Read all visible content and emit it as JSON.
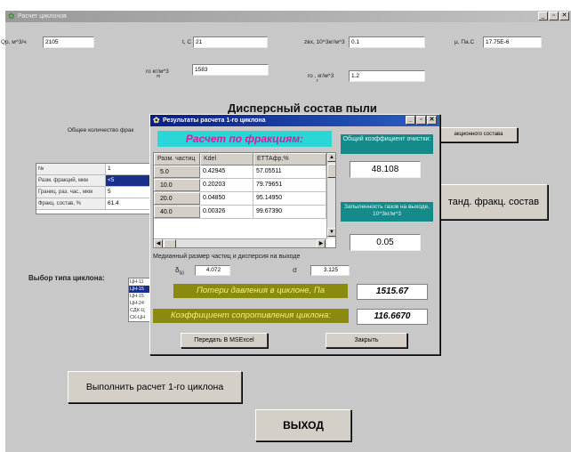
{
  "main_window": {
    "title": "Расчет циклонов",
    "title_buttons": [
      "_",
      "▫",
      "✕"
    ]
  },
  "inputs_row1": [
    {
      "label": "Qр, м^3/ч",
      "value": "2105"
    },
    {
      "label": "t, C",
      "value": "21"
    },
    {
      "label": "zвх, 10^3кг/м^3",
      "value": "0.1"
    },
    {
      "label": "μ, Па.С",
      "value": "17.75E-6"
    }
  ],
  "inputs_row2": [
    {
      "label": "ro  кг/м^3",
      "sub": "m",
      "value": "1583"
    },
    {
      "label": "ro , кг/м^3",
      "sub": "г",
      "value": "1.2"
    }
  ],
  "dispersion_heading": "Дисперсный состав пыли",
  "total_fractions_label": "Общее количество фрак",
  "fraction_comp_button": "акционного состава",
  "standard_comp_button": "танд. фракц. состав",
  "fraction_grid": [
    {
      "label": "№",
      "value": "1",
      "selected": false
    },
    {
      "label": "Разм. фракций, мкм",
      "value": "<5",
      "selected": true
    },
    {
      "label": "Границ. раз. час., мкм",
      "value": "5",
      "selected": false
    },
    {
      "label": "Фракц. состав, %",
      "value": "61.4",
      "selected": false
    }
  ],
  "cyclone_type_label": "Выбор типа циклона:",
  "cyclone_types": [
    "ЦН-11",
    "ЦН-15",
    "ЦН-15",
    "ЦН-24",
    "СДК-Ц",
    "СК-ЦН"
  ],
  "run_button": "Выполнить расчет 1-го циклона",
  "exit_button": "ВЫХОД",
  "dialog": {
    "title": "Результаты расчета 1-го циклона",
    "title_buttons": [
      "_",
      "▫",
      "✕"
    ],
    "fractions_banner": "Расчет по фракциям:",
    "table": {
      "headers": [
        "Разм. частиц",
        "Kdel",
        "ЕТТАфр,%"
      ],
      "rows": [
        [
          "5.0",
          "0.42945",
          "57.05511"
        ],
        [
          "10.0",
          "0.20203",
          "79.79651"
        ],
        [
          "20.0",
          "0.04850",
          "95.14950"
        ],
        [
          "40.0",
          "0.00326",
          "99.67390"
        ]
      ]
    },
    "overall_eff_label": "Общий коэффициент очистки:",
    "overall_eff_value": "48.108",
    "outlet_dust_label": "Запыленность газов на выходе, 10^3кг/м^3",
    "outlet_dust_value": "0.05",
    "median_label": "Медианный размер частиц и дисперсия на выходе",
    "d50_symbol": "δ",
    "d50_sub": "50",
    "d50_value": "4.072",
    "sigma_symbol": "σ",
    "sigma_value": "3.125",
    "pressure_loss_label": "Потери давления в циклоне,  Па",
    "pressure_loss_value": "1515.67",
    "resistance_label": "Коэффициент сопротивления циклона:",
    "resistance_value": "116.6670",
    "excel_button": "Передать В MSExcel",
    "close_button": "Закрыть"
  },
  "colors": {
    "selection": "#1a2f8a",
    "banner_cyan": "#2ad6d6",
    "banner_magenta": "#e018a0",
    "teal": "#148a8a",
    "olive": "#8a8a10"
  }
}
